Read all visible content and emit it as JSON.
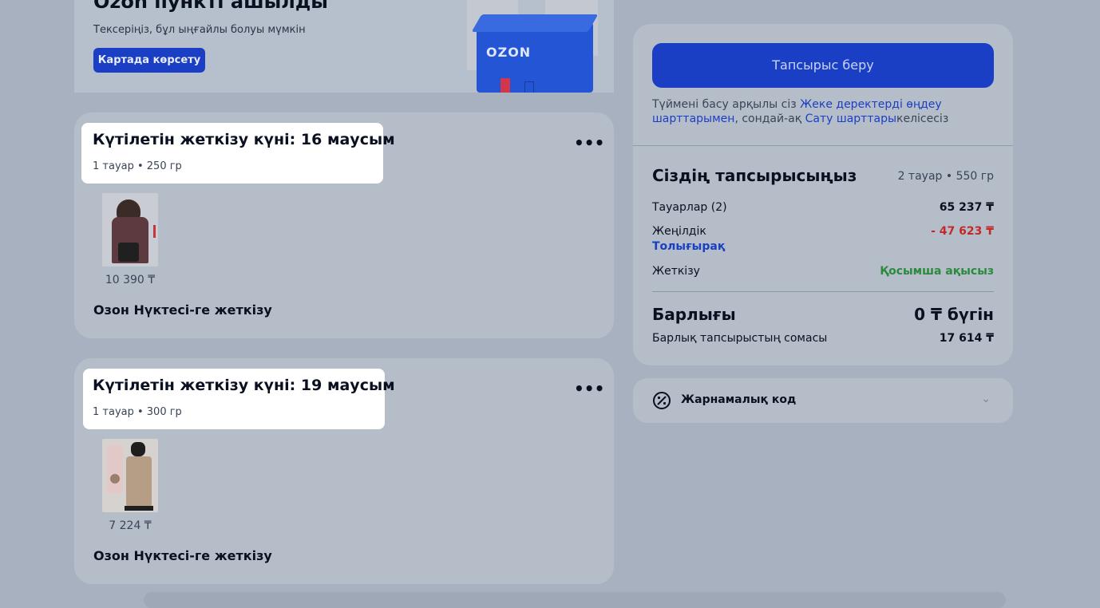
{
  "banner": {
    "title": "Ozon пункті ашылды",
    "subtitle": "Тексеріңіз, бұл ыңғайлы болуы мүмкін",
    "button_label": "Картада көрсету",
    "brand_text": "OZON"
  },
  "shipments": [
    {
      "title": "Күтілетін жеткізу күні: 16 маусым",
      "meta": "1 тауар • 250 гр",
      "more_icon": "•••",
      "item_price": "10 390 ₸",
      "delivery_method": "Озон Нүктесі-ге жеткізу"
    },
    {
      "title": "Күтілетін жеткізу күні: 19 маусым",
      "meta": "1 тауар • 300 гр",
      "more_icon": "•••",
      "item_price": "7 224 ₸",
      "delivery_method": "Озон Нүктесі-ге жеткізу"
    }
  ],
  "summary": {
    "order_button": "Тапсырыс беру",
    "terms_prefix": "Түймені басу арқылы сіз ",
    "terms_link1": "Жеке деректерді өңдеу шарттарымен",
    "terms_mid": ", сондай-ақ ",
    "terms_link2": "Сату шарттары",
    "terms_suffix": "келісесіз",
    "title": "Сіздің тапсырысыңыз",
    "meta": "2 тауар • 550 гр",
    "rows": [
      {
        "label": "Тауарлар (2)",
        "value": "65 237 ₸"
      },
      {
        "label": "Жеңілдік",
        "value": "- 47 623 ₸",
        "link": "Толығырақ"
      },
      {
        "label": "Жеткізу",
        "value": "Қосымша ақысыз"
      }
    ],
    "total_label": "Барлығы",
    "total_value": "0 ₸ бүгін",
    "order_sum_label": "Барлық тапсырыстың сомасы",
    "order_sum_value": "17 614 ₸"
  },
  "promo": {
    "label": "Жарнамалық код",
    "icon": "percent-badge-icon",
    "chevron": "⌄"
  },
  "colors": {
    "accent": "#1a3fc4",
    "discount": "#c22a2a",
    "free": "#2c8a3e"
  }
}
